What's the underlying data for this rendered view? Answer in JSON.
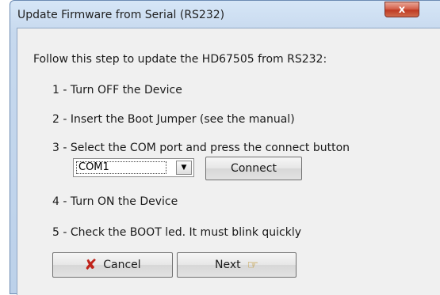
{
  "window": {
    "title": "Update Firmware from Serial (RS232)",
    "close_label": "x"
  },
  "intro": "Follow this step to update the HD67505 from RS232:",
  "steps": [
    "1 - Turn OFF the Device",
    "2 - Insert the Boot Jumper (see the manual)",
    "3 - Select the  COM port and press the connect button",
    "4 - Turn ON the Device",
    "5 - Check the BOOT led. It must blink quickly"
  ],
  "com_port": {
    "selected": "COM1",
    "arrow_icon": "chevron-down-icon"
  },
  "buttons": {
    "connect": "Connect",
    "cancel": "Cancel",
    "cancel_icon": "red-x-icon",
    "next": "Next",
    "next_icon": "pointing-hand-icon"
  },
  "colors": {
    "title_bar": "#c7d9ee",
    "close_button": "#c94a34",
    "cancel_icon": "#c0231a",
    "dialog_body": "#f0f0f0"
  }
}
